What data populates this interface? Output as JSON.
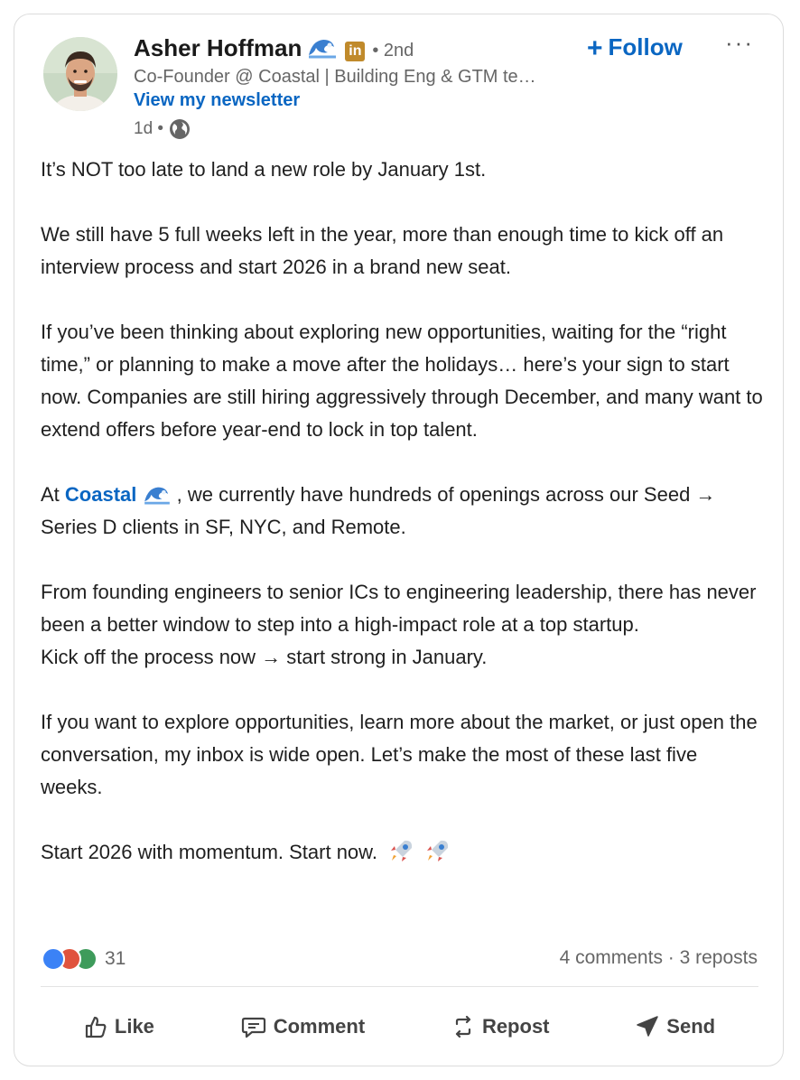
{
  "author": {
    "name": "Asher Hoffman",
    "degree": "• 2nd",
    "headline": "Co-Founder @ Coastal | Building Eng & GTM te…",
    "newsletter_link": "View my newsletter",
    "posted_time": "1d •",
    "linkedin_badge": "in"
  },
  "header": {
    "follow_label": "Follow",
    "more_label": "···"
  },
  "post": {
    "line1": "It’s NOT too late to land a new role by January 1st.",
    "para2": "We still have 5 full weeks left in the year, more than enough time to kick off an interview process and start 2026 in a brand new seat.",
    "para3": "If you’ve been thinking about exploring new opportunities, waiting for the “right time,” or planning to make a move after the holidays… here’s your sign to start now. Companies are still hiring aggressively through December, and many want to extend offers before year-end to lock in top talent.",
    "para4_prefix": "At ",
    "para4_mention": "Coastal",
    "para4_suffix": " , we currently have hundreds of openings across our Seed → Series D clients in SF, NYC, and Remote.",
    "para5a": "From founding engineers to senior ICs to engineering leadership, there has never been a better window to step into a high-impact role at a top startup.",
    "para5b": "Kick off the process now → start strong in January.",
    "para6": "If you want to explore opportunities, learn more about the market, or just open the conversation, my inbox is wide open. Let’s make the most of these last five weeks.",
    "para7": "Start 2026 with momentum. Start now."
  },
  "social": {
    "reaction_count": "31",
    "stats": "4 comments · 3 reposts"
  },
  "actions": {
    "like": "Like",
    "comment": "Comment",
    "repost": "Repost",
    "send": "Send"
  },
  "colors": {
    "accent": "#0a66c2",
    "text": "#1f1f1f",
    "muted": "#666666"
  }
}
